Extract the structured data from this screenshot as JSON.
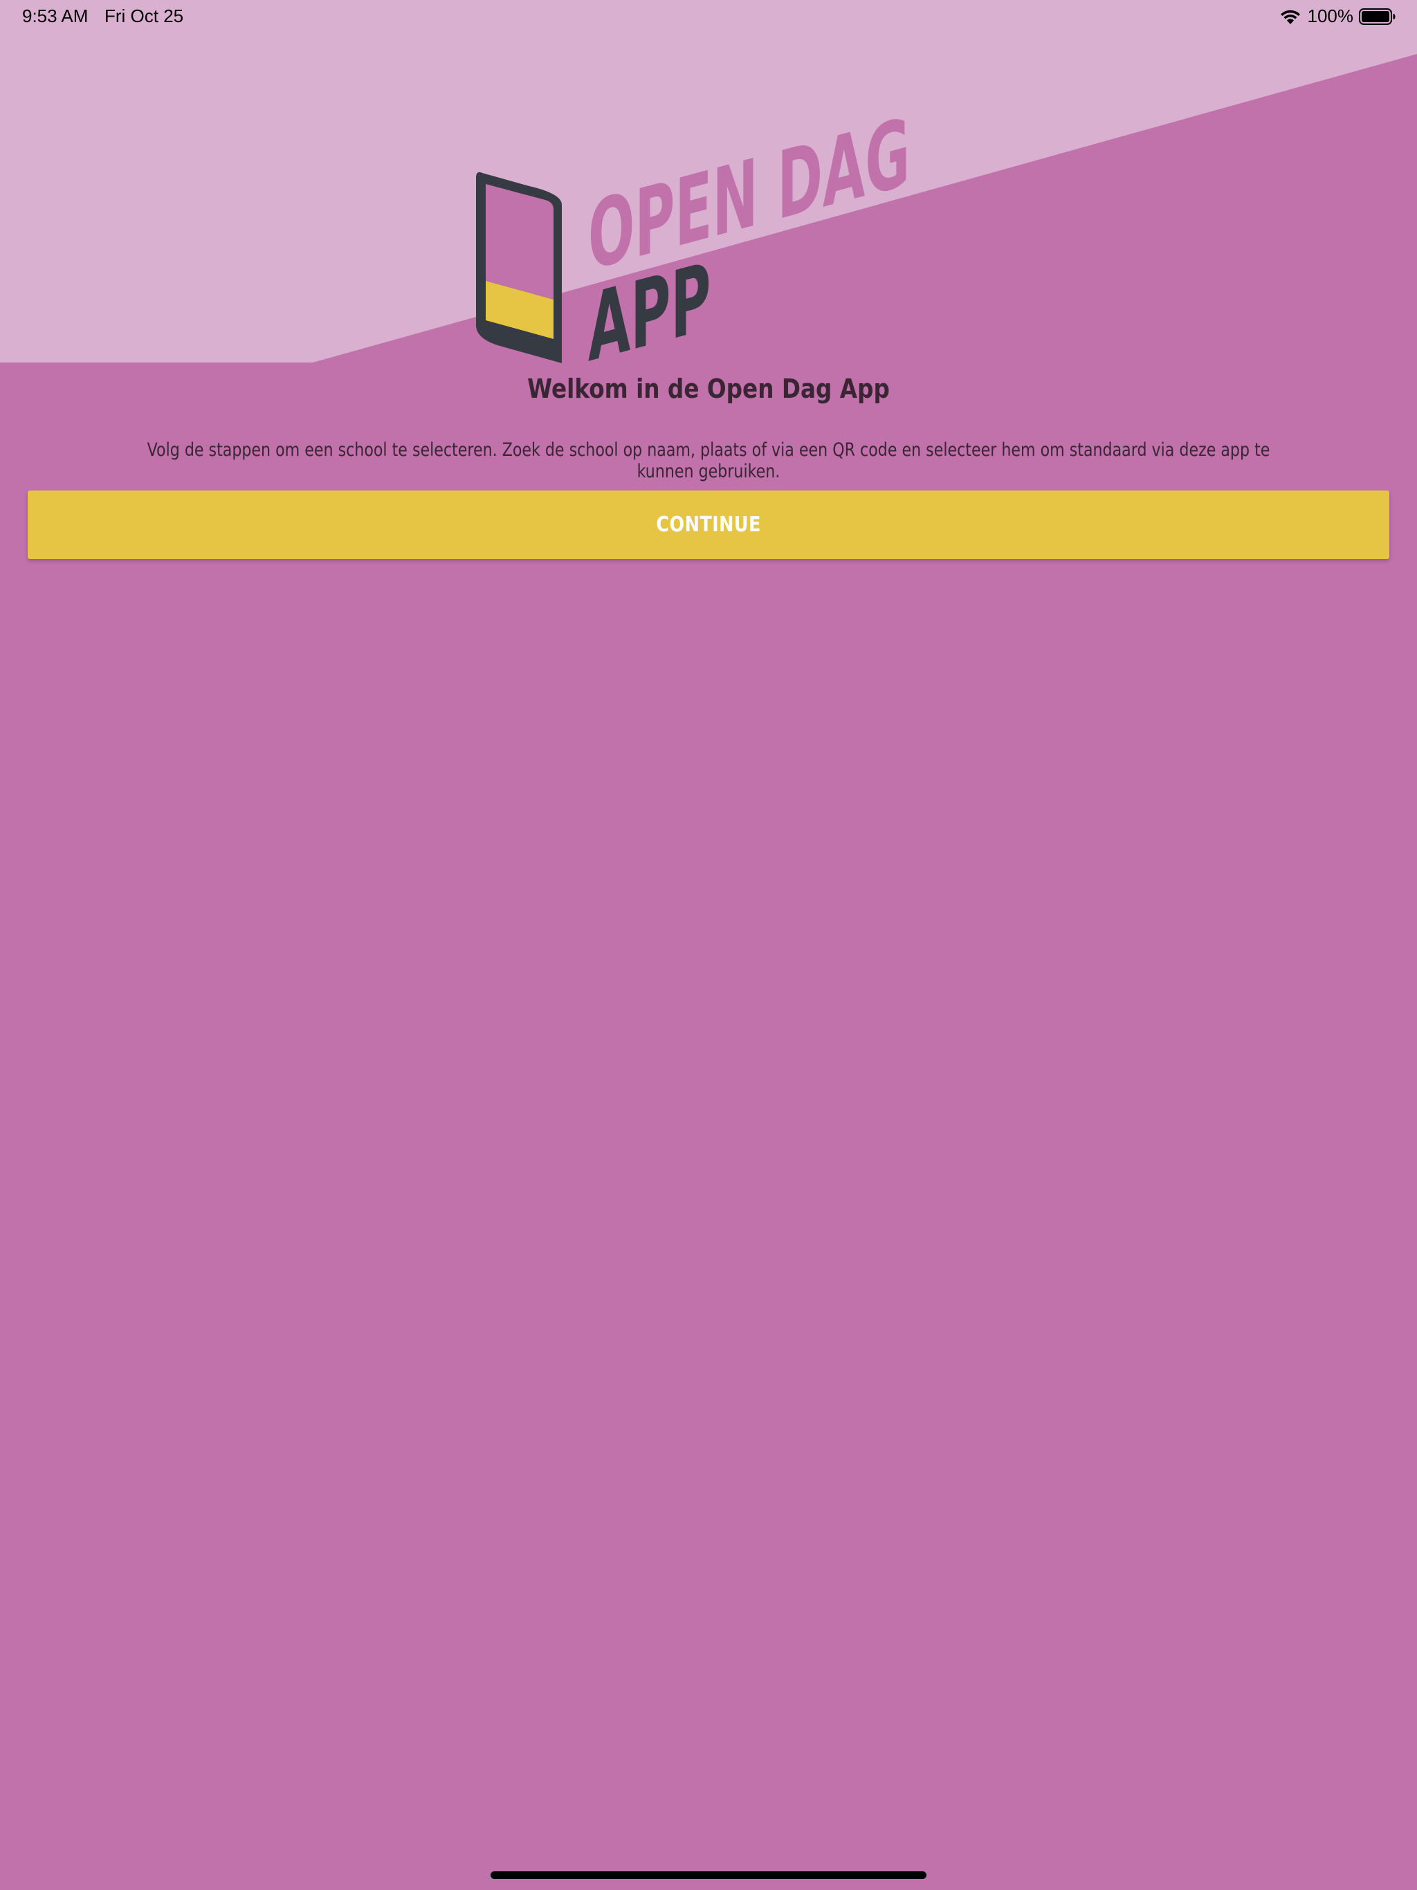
{
  "status_bar": {
    "time": "9:53 AM",
    "date": "Fri Oct 25",
    "battery_percent": "100%",
    "battery_level": 1.0,
    "icons": [
      "wifi-icon",
      "battery-icon"
    ]
  },
  "logo": {
    "line1": "OPEN DAG",
    "line2": "APP",
    "icon": "phone-icon"
  },
  "welcome": {
    "title": "Welkom in de Open Dag App",
    "description": "Volg de stappen om een school te selecteren. Zoek de school op naam, plaats of via een QR code en selecteer hem om standaard via deze app te kunnen gebruiken."
  },
  "actions": {
    "continue_label": "CONTINUE"
  },
  "colors": {
    "background": "#c172ab",
    "background_light": "#d9b0cf",
    "logo_light": "#c172ab",
    "logo_dark": "#363a43",
    "accent_yellow": "#e6c444",
    "text_dark": "#3a2535",
    "button_text": "#ffffff"
  }
}
